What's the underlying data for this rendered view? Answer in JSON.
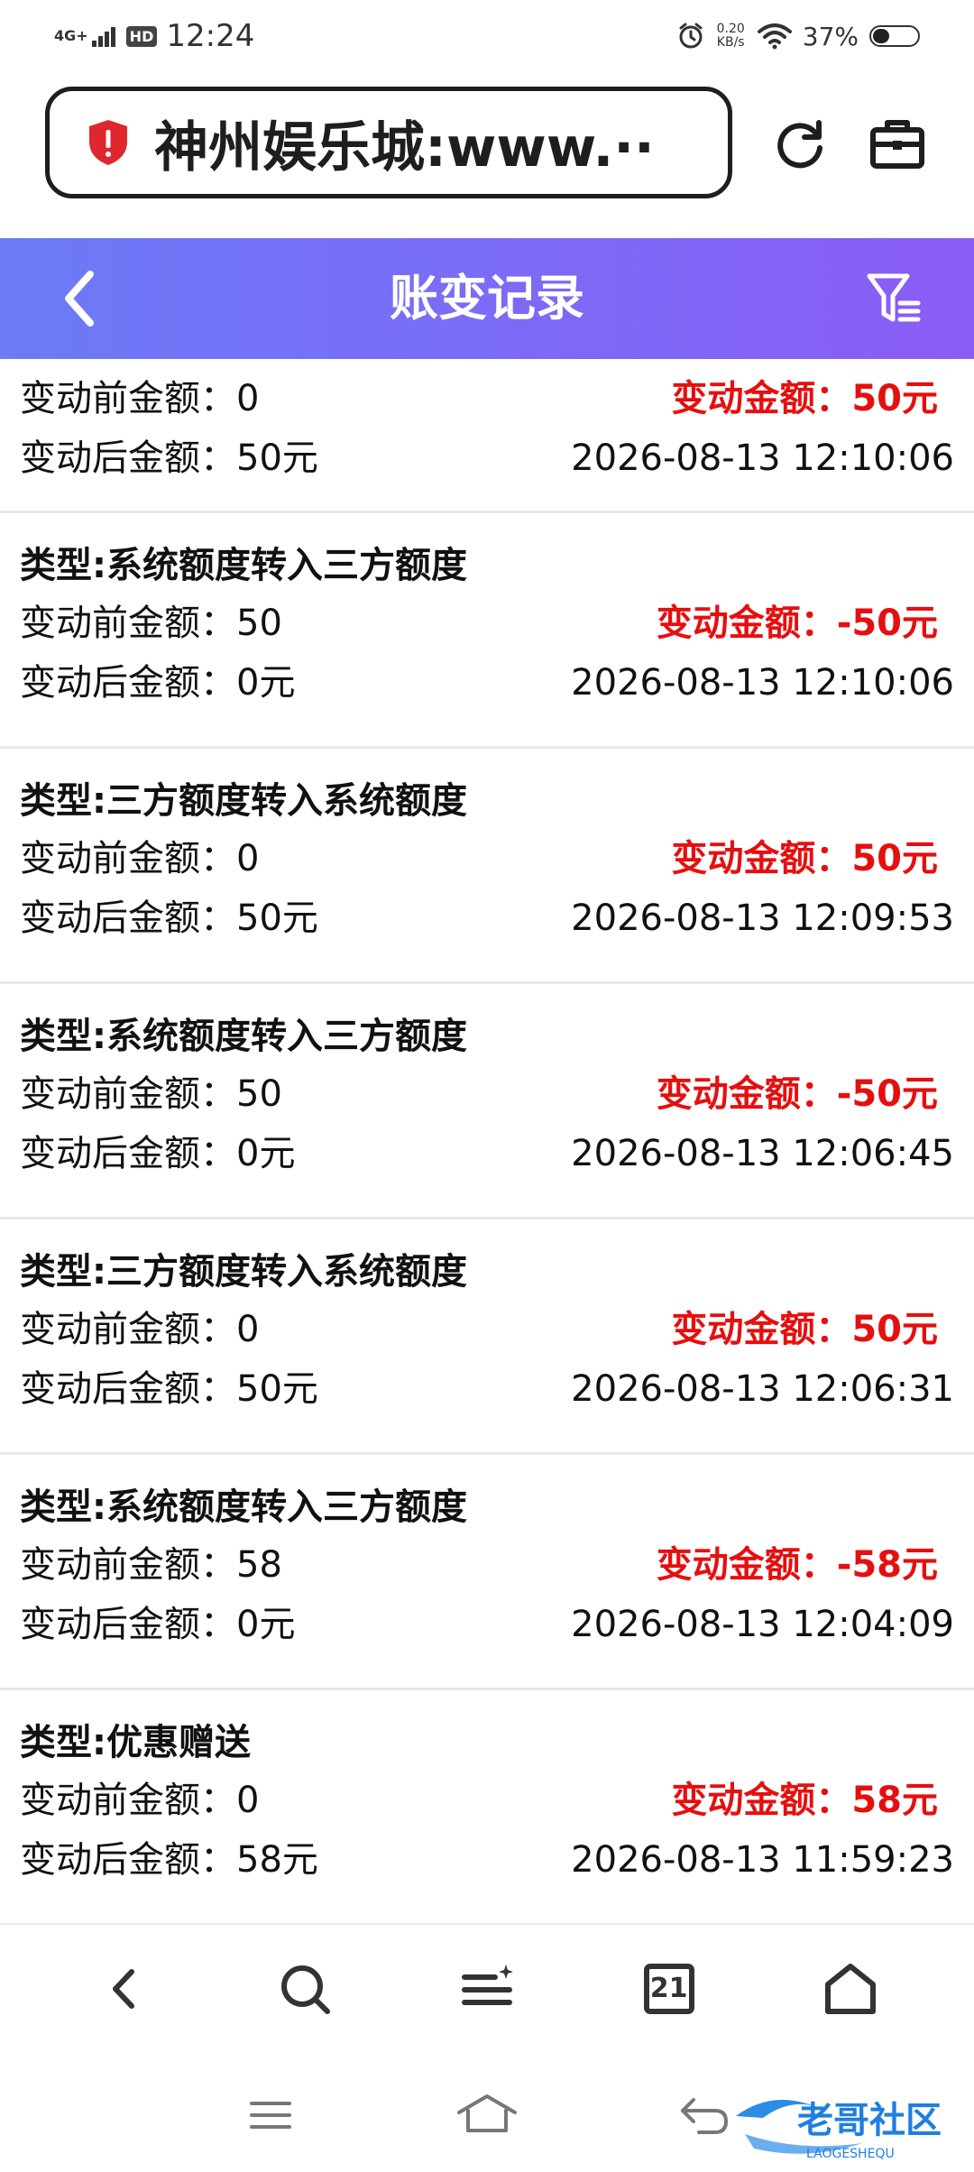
{
  "status_bar": {
    "network": "4G+",
    "hd": "HD",
    "time": "12:24",
    "net_speed_value": "0.20",
    "net_speed_unit": "KB/s",
    "battery": "37%",
    "battery_level": 0.37
  },
  "browser": {
    "url_text": "神州娱乐城:www.···",
    "shield_color": "#e0262e"
  },
  "header": {
    "title": "账变记录",
    "gradient_start": "#6c7bf7",
    "gradient_end": "#8a5cf6"
  },
  "records": [
    {
      "type": "",
      "before": "变动前金额：0",
      "change": "变动金额：50元",
      "after": "变动后金额：50元",
      "time": "2026-08-13 12:10:06"
    },
    {
      "type": "类型:系统额度转入三方额度",
      "before": "变动前金额：50",
      "change": "变动金额：-50元",
      "after": "变动后金额：0元",
      "time": "2026-08-13 12:10:06"
    },
    {
      "type": "类型:三方额度转入系统额度",
      "before": "变动前金额：0",
      "change": "变动金额：50元",
      "after": "变动后金额：50元",
      "time": "2026-08-13 12:09:53"
    },
    {
      "type": "类型:系统额度转入三方额度",
      "before": "变动前金额：50",
      "change": "变动金额：-50元",
      "after": "变动后金额：0元",
      "time": "2026-08-13 12:06:45"
    },
    {
      "type": "类型:三方额度转入系统额度",
      "before": "变动前金额：0",
      "change": "变动金额：50元",
      "after": "变动后金额：50元",
      "time": "2026-08-13 12:06:31"
    },
    {
      "type": "类型:系统额度转入三方额度",
      "before": "变动前金额：58",
      "change": "变动金额：-58元",
      "after": "变动后金额：0元",
      "time": "2026-08-13 12:04:09"
    },
    {
      "type": "类型:优惠赠送",
      "before": "变动前金额：0",
      "change": "变动金额：58元",
      "after": "变动后金额：58元",
      "time": "2026-08-13 11:59:23"
    }
  ],
  "bottom_nav": {
    "tab_count": "21"
  },
  "watermark": {
    "text": "老哥社区",
    "subtext": "LAOGESHEQU"
  },
  "colors": {
    "change_amount": "#e60f0f",
    "divider": "#e8e8e8"
  }
}
